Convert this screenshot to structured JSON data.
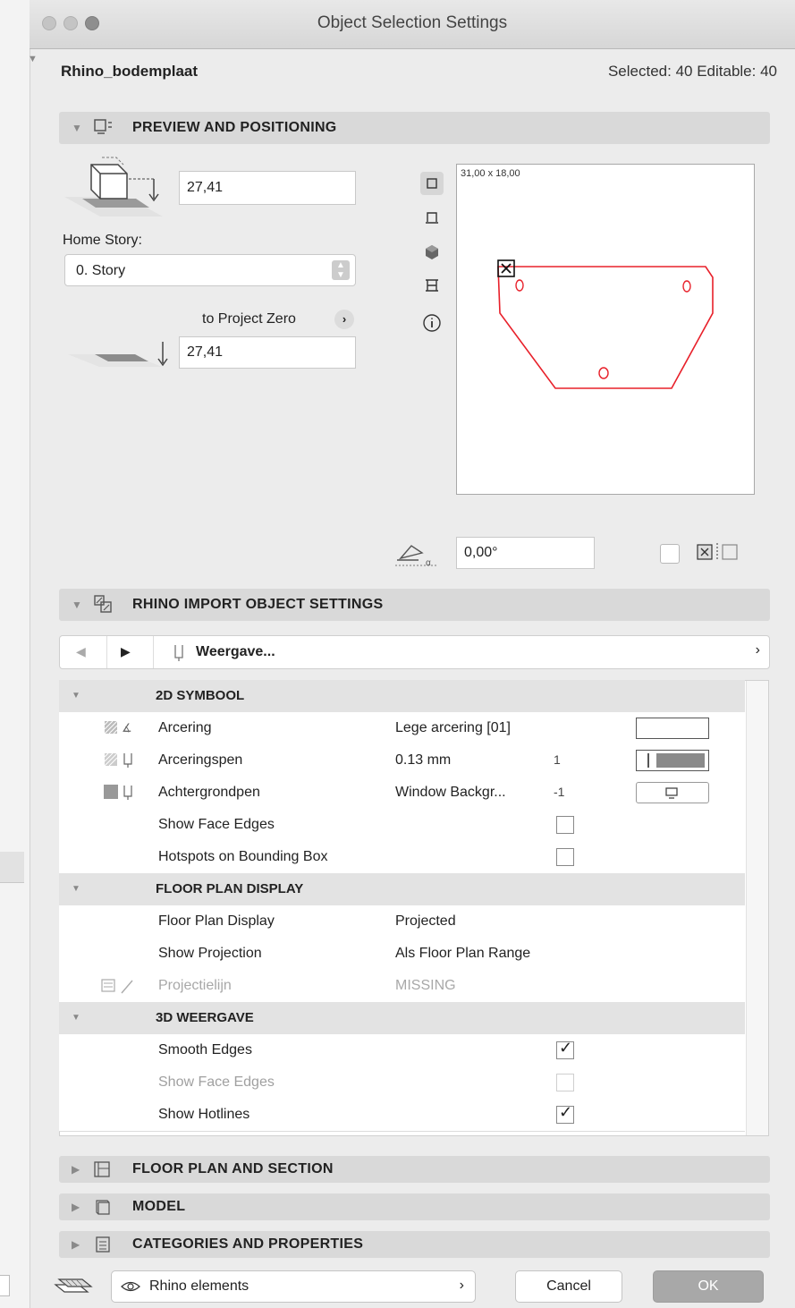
{
  "window": {
    "title": "Object Selection Settings"
  },
  "header": {
    "object_name": "Rhino_bodemplaat",
    "selection_info": "Selected: 40 Editable: 40"
  },
  "preview_section": {
    "label": "PREVIEW AND POSITIONING",
    "elevation_value": "27,41",
    "home_story_label": "Home Story:",
    "home_story_value": "0. Story",
    "to_project_zero_label": "to Project Zero",
    "project_zero_value": "27,41",
    "preview_size_text": "31,00 x 18,00",
    "rotation_value": "0,00°"
  },
  "rhino_section": {
    "label": "RHINO IMPORT OBJECT SETTINGS",
    "nav_label": "Weergave...",
    "groups": [
      {
        "label": "2D SYMBOOL"
      },
      {
        "label": "FLOOR PLAN DISPLAY"
      },
      {
        "label": "3D WEERGAVE"
      }
    ],
    "rows": [
      {
        "name": "Arcering",
        "value": "Lege arcering [01]"
      },
      {
        "name": "Arceringspen",
        "value": "0.13 mm",
        "extra": "1"
      },
      {
        "name": "Achtergrondpen",
        "value": "Window Backgr...",
        "extra": "-1"
      },
      {
        "name": "Show Face Edges"
      },
      {
        "name": "Hotspots on Bounding Box"
      },
      {
        "name": "Floor Plan Display",
        "value": "Projected"
      },
      {
        "name": "Show Projection",
        "value": "Als Floor Plan Range"
      },
      {
        "name": "Projectielijn",
        "value": "MISSING"
      },
      {
        "name": "Smooth Edges",
        "checked": true
      },
      {
        "name": "Show Face Edges",
        "checked": false
      },
      {
        "name": "Show Hotlines",
        "checked": true
      }
    ]
  },
  "collapsed_sections": [
    {
      "label": "FLOOR PLAN AND SECTION"
    },
    {
      "label": "MODEL"
    },
    {
      "label": "CATEGORIES AND PROPERTIES"
    }
  ],
  "footer": {
    "layer_label": "Rhino elements",
    "cancel_label": "Cancel",
    "ok_label": "OK"
  },
  "colors": {
    "shape_stroke": "#e8202a",
    "ok_button": "#a8a8a8"
  }
}
